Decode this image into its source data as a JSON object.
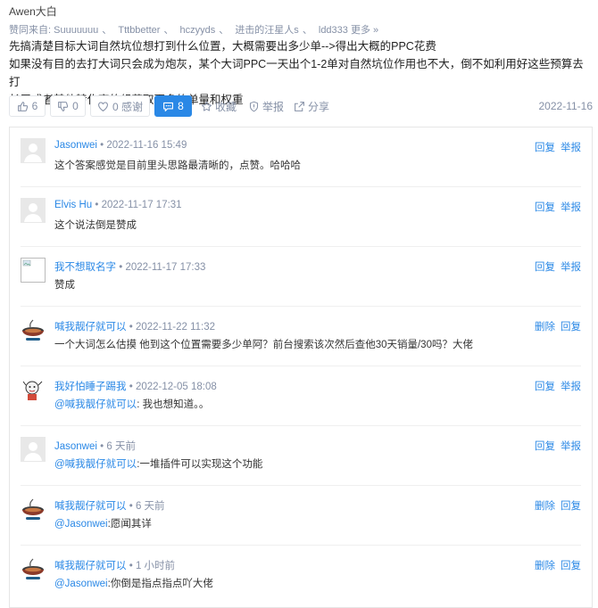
{
  "post": {
    "author": "Awen大白",
    "liked_by_prefix": "赞同来自:",
    "liked_by": [
      "Suuuuuuu",
      "Tttbbetter",
      "hczyyds",
      "进击的汪星人s",
      "ldd333"
    ],
    "liked_by_more": "更多 »",
    "lines": [
      "先搞清楚目标大词自然坑位想打到什么位置，大概需要出多少单-->得出大概的PPC花费",
      "如果没有目的去打大词只会成为炮灰，某个大词PPC一天出个1-2单对自然坑位作用也不大，倒不如利用好这些预算去打",
      "长尾或者其他转化高的组获取更多的单量和权重"
    ],
    "date": "2022-11-16"
  },
  "actions": {
    "upvote_count": "6",
    "downvote_count": "0",
    "thanks": "0 感谢",
    "comment_count": "8",
    "favorite": "收藏",
    "report": "举报",
    "share": "分享"
  },
  "colors": {
    "accent": "#2a88e6",
    "muted": "#8590a6"
  },
  "comments": [
    {
      "name": "Jasonwei",
      "time": "2022-11-16 15:49",
      "text_at": "",
      "text": "这个答案感觉是目前里头思路最清晰的，点赞。哈哈哈",
      "ops": [
        "回复",
        "举报"
      ],
      "avatar": "default-avatar"
    },
    {
      "name": "Elvis Hu",
      "time": "2022-11-17 17:31",
      "text_at": "",
      "text": "这个说法倒是赞成",
      "ops": [
        "回复",
        "举报"
      ],
      "avatar": "default-avatar"
    },
    {
      "name": "我不想取名字",
      "time": "2022-11-17 17:33",
      "text_at": "",
      "text": "赞成",
      "ops": [
        "回复",
        "举报"
      ],
      "avatar": "broken-image"
    },
    {
      "name": "喊我靓仔就可以",
      "time": "2022-11-22 11:32",
      "text_at": "",
      "text": "一个大词怎么估摸 他到这个位置需要多少单阿？前台搜索该次然后查他30天销量/30吗？大佬",
      "ops": [
        "删除",
        "回复"
      ],
      "avatar": "bowl-avatar"
    },
    {
      "name": "我好怕睡子踢我",
      "time": "2022-12-05 18:08",
      "text_at": "@喊我靓仔就可以",
      "text": ": 我也想知道。。",
      "ops": [
        "回复",
        "举报"
      ],
      "avatar": "cartoon-avatar"
    },
    {
      "name": "Jasonwei",
      "time": "6 天前",
      "text_at": "@喊我靓仔就可以",
      "text": ":一堆插件可以实现这个功能",
      "ops": [
        "回复",
        "举报"
      ],
      "avatar": "default-avatar"
    },
    {
      "name": "喊我靓仔就可以",
      "time": "6 天前",
      "text_at": "@Jasonwei",
      "text": ":愿闻其详",
      "ops": [
        "删除",
        "回复"
      ],
      "avatar": "bowl-avatar"
    },
    {
      "name": "喊我靓仔就可以",
      "time": "1 小时前",
      "text_at": "@Jasonwei",
      "text": ":你倒是指点指点吖大佬",
      "ops": [
        "删除",
        "回复"
      ],
      "avatar": "bowl-avatar"
    }
  ]
}
